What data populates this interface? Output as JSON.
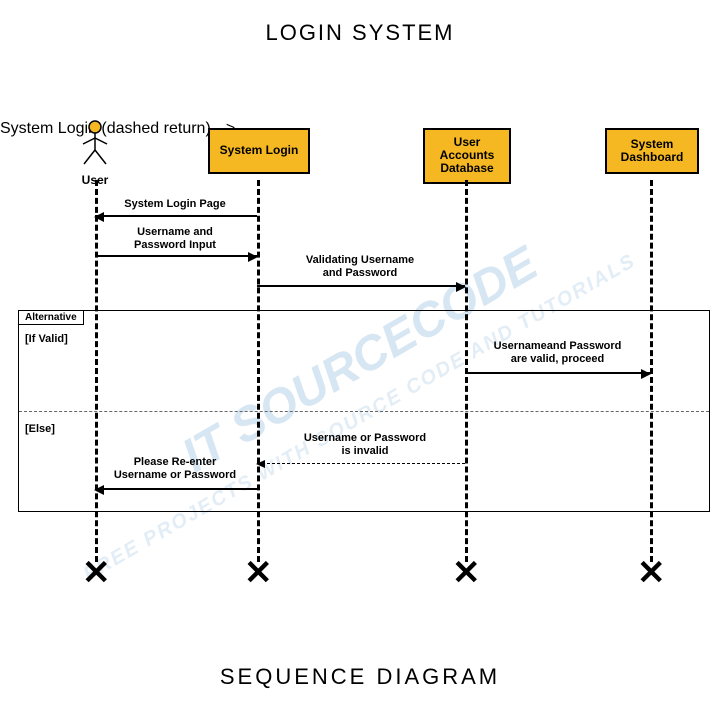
{
  "title": "LOGIN SYSTEM",
  "subtitle": "SEQUENCE DIAGRAM",
  "watermark": "IT SOURCECODE",
  "watermark_sub": "FREE PROJECTS WITH SOURCE CODE AND TUTORIALS",
  "participants": {
    "user": "User",
    "system_login": "System Login",
    "db": "User Accounts Database",
    "dash": "System Dashboard"
  },
  "messages": {
    "m1": "System Login Page",
    "m2": "Username and\nPassword Input",
    "m3": "Validating Username\nand Password",
    "m4": "Usernameand Password\nare valid, proceed",
    "m5": "Username or Password\nis invalid",
    "m6": "Please Re-enter\nUsername or Password"
  },
  "alt": {
    "label": "Alternative",
    "if": "[If Valid]",
    "else": "[Else]"
  }
}
